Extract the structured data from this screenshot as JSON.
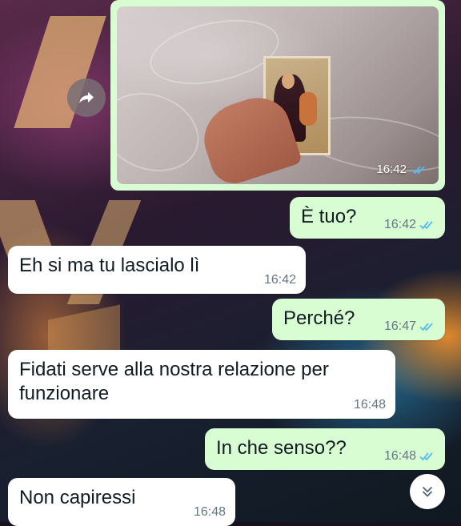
{
  "colors": {
    "outgoing_bubble": "#d9fdd3",
    "incoming_bubble": "#ffffff",
    "read_tick": "#53bdeb",
    "meta_text": "#667781"
  },
  "icons": {
    "forward": "forward-arrow-icon",
    "read_receipt": "double-check-icon",
    "scroll": "double-chevron-down-icon"
  },
  "photo_message": {
    "time": "16:42",
    "status": "read"
  },
  "messages": [
    {
      "direction": "out",
      "text": "È tuo?",
      "time": "16:42",
      "status": "read"
    },
    {
      "direction": "in",
      "text": "Eh si ma tu lascialo lì",
      "time": "16:42"
    },
    {
      "direction": "out",
      "text": "Perché?",
      "time": "16:47",
      "status": "read"
    },
    {
      "direction": "in",
      "line1": "Fidati serve alla nostra relazione per",
      "line2": "funzionare",
      "time": "16:48"
    },
    {
      "direction": "out",
      "text": "In che senso??",
      "time": "16:48",
      "status": "read"
    },
    {
      "direction": "in",
      "text": "Non capiressi",
      "time": "16:48"
    }
  ]
}
